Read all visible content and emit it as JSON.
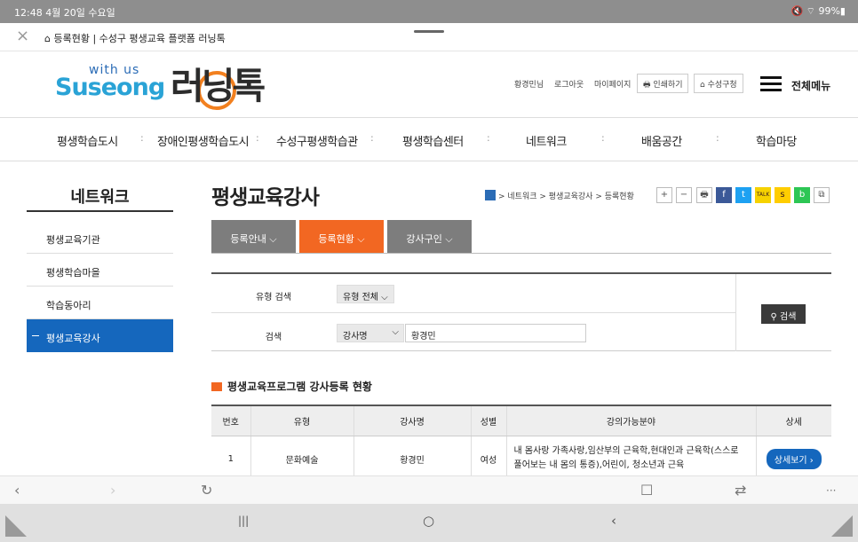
{
  "status": {
    "time": "12:48  4월 20일 수요일",
    "right": "🔇 ⌔ 99%▮"
  },
  "browser_tab": {
    "title": "⌂ 등록현황 | 수성구 평생교육 플랫폼 러닝톡"
  },
  "logo": {
    "with_us": "with us",
    "suseong": "Suseong",
    "main": "러닝톡"
  },
  "header": {
    "user": "황경민님",
    "logout": "로그아웃",
    "mypage": "마이페이지",
    "print": "인쇄하기",
    "gu": "수성구청",
    "menu": "전체메뉴"
  },
  "gnb": [
    "평생학습도시",
    "장애인평생학습도시",
    "수성구평생학습관",
    "평생학습센터",
    "네트워크",
    "배움공간",
    "학습마당"
  ],
  "sidebar": {
    "title": "네트워크",
    "items": [
      "평생교육기관",
      "평생학습마을",
      "학습동아리",
      "평생교육강사"
    ]
  },
  "content": {
    "title": "평생교육강사",
    "breadcrumb": "> 네트워크 > 평생교육강사 > 등록현황",
    "tabs": [
      "등록안내 ⌵",
      "등록현황 ⌵",
      "강사구인 ⌵"
    ]
  },
  "share": {
    "plus": "+",
    "minus": "−",
    "print": "🖶",
    "facebook": "f",
    "twitter": "t",
    "talk": "TALK",
    "story": "s",
    "band": "b",
    "link": "⧉"
  },
  "search": {
    "type_label": "유형 검색",
    "type_value": "유형 전체  ⌵",
    "keyword_label": "검색",
    "keyword_select": "강사명",
    "keyword_select_arrow": "⌵",
    "keyword_value": "황경민",
    "button": "검색"
  },
  "section": {
    "title": "평생교육프로그램 강사등록 현황"
  },
  "table": {
    "headers": [
      "번호",
      "유형",
      "강사명",
      "성별",
      "강의가능분야",
      "상세"
    ],
    "rows": [
      {
        "no": "1",
        "type": "문화예술",
        "name": "황경민",
        "gender": "여성",
        "field": "내 몸사랑 가족사랑,임산부의 근육학,현대인과 근육학(스스로 풀어보는 내 몸의 통증),어린이, 청소년과 근육",
        "detail": "상세보기 ›"
      }
    ]
  },
  "browser_nav": {
    "back": "‹",
    "forward": "›",
    "reload": "↻",
    "bookmark": "☐",
    "tabs": "⇄",
    "more": "···"
  },
  "system_nav": {
    "recent": "|||",
    "home": "○",
    "back": "‹"
  }
}
